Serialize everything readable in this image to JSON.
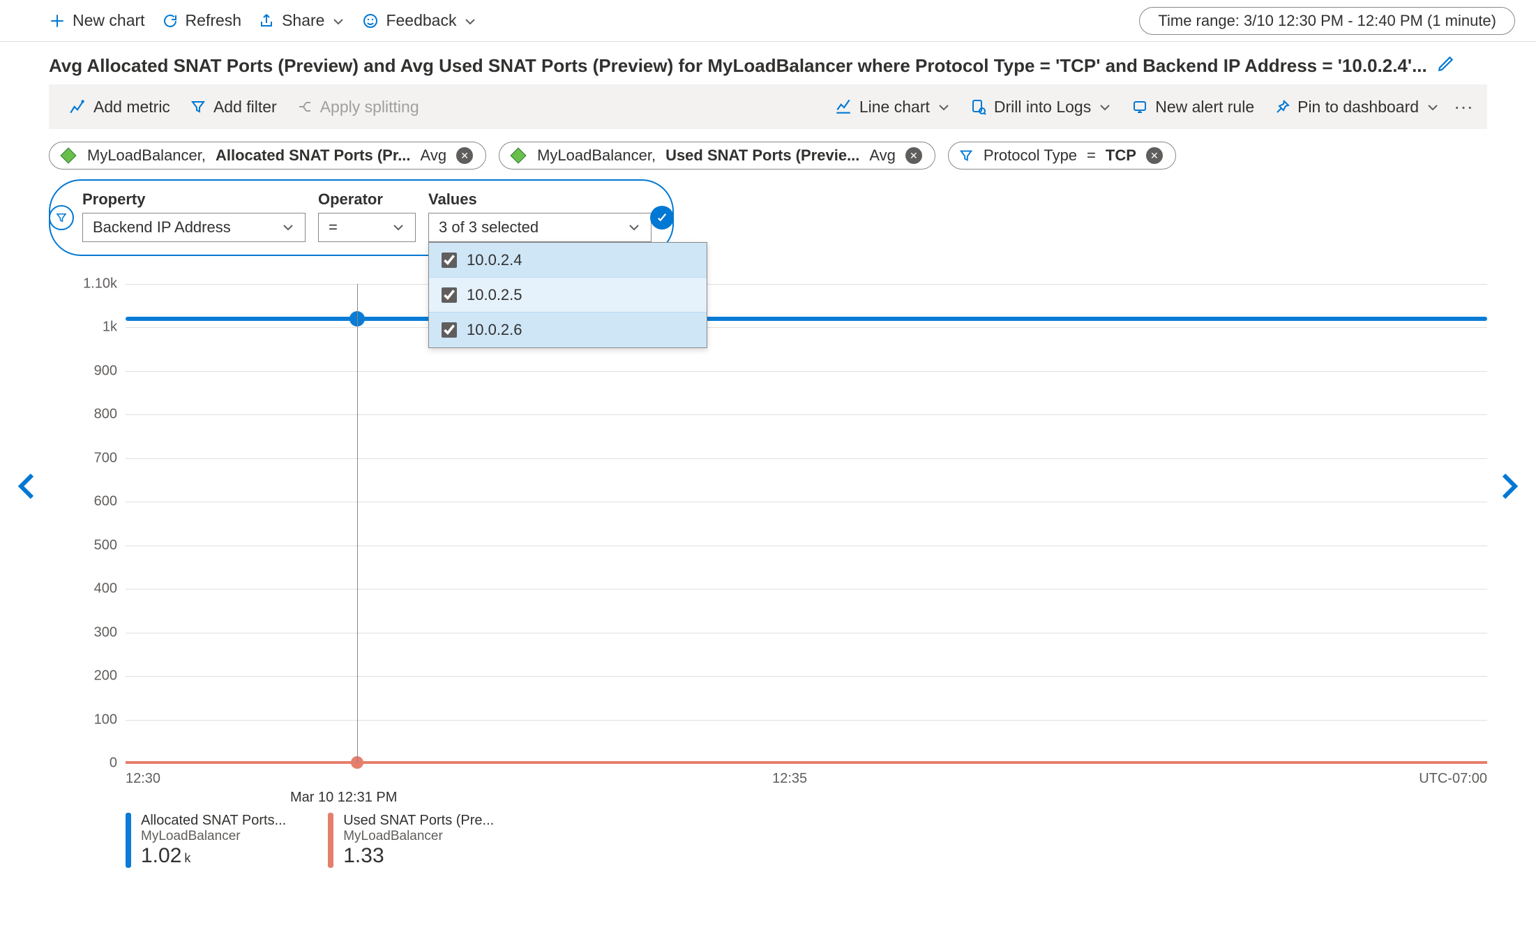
{
  "cmdbar": {
    "newChart": "New chart",
    "refresh": "Refresh",
    "share": "Share",
    "feedback": "Feedback",
    "timeRange": "Time range: 3/10 12:30 PM - 12:40 PM (1 minute)"
  },
  "title": {
    "text": "Avg Allocated SNAT Ports (Preview) and Avg Used SNAT Ports (Preview) for MyLoadBalancer where Protocol Type = 'TCP' and Backend IP Address = '10.0.2.4'..."
  },
  "toolbar": {
    "addMetric": "Add metric",
    "addFilter": "Add filter",
    "applySplit": "Apply splitting",
    "chartType": "Line chart",
    "drill": "Drill into Logs",
    "alert": "New alert rule",
    "pin": "Pin to dashboard"
  },
  "pills": {
    "metric1_res": "MyLoadBalancer,",
    "metric1_name": "Allocated SNAT Ports (Pr...",
    "metric1_agg": "Avg",
    "metric2_res": "MyLoadBalancer,",
    "metric2_name": "Used SNAT Ports (Previe...",
    "metric2_agg": "Avg",
    "filter_prop": "Protocol Type",
    "filter_op": "=",
    "filter_val": "TCP"
  },
  "filterEditor": {
    "propertyLabel": "Property",
    "operatorLabel": "Operator",
    "valuesLabel": "Values",
    "propertyValue": "Backend IP Address",
    "operatorValue": "=",
    "valuesSelected": "3 of 3 selected",
    "options": [
      "10.0.2.4",
      "10.0.2.5",
      "10.0.2.6"
    ]
  },
  "chart_data": {
    "type": "line",
    "title": "",
    "xlabel": "",
    "ylabel": "",
    "ylim": [
      0,
      1100
    ],
    "yticks": [
      "0",
      "100",
      "200",
      "300",
      "400",
      "500",
      "600",
      "700",
      "800",
      "900",
      "1k",
      "1.10k"
    ],
    "xStart": "12:30",
    "xMid": "12:35",
    "hoverTime": "Mar 10 12:31 PM",
    "tz": "UTC-07:00",
    "series": [
      {
        "name": "Allocated SNAT Ports...",
        "resource": "MyLoadBalancer",
        "color": "#0a7cd6",
        "flatValue": 1020,
        "displayValue": "1.02",
        "displayUnit": "k"
      },
      {
        "name": "Used SNAT Ports (Pre...",
        "resource": "MyLoadBalancer",
        "color": "#e57f6c",
        "flatValue": 1.33,
        "displayValue": "1.33",
        "displayUnit": ""
      }
    ]
  }
}
